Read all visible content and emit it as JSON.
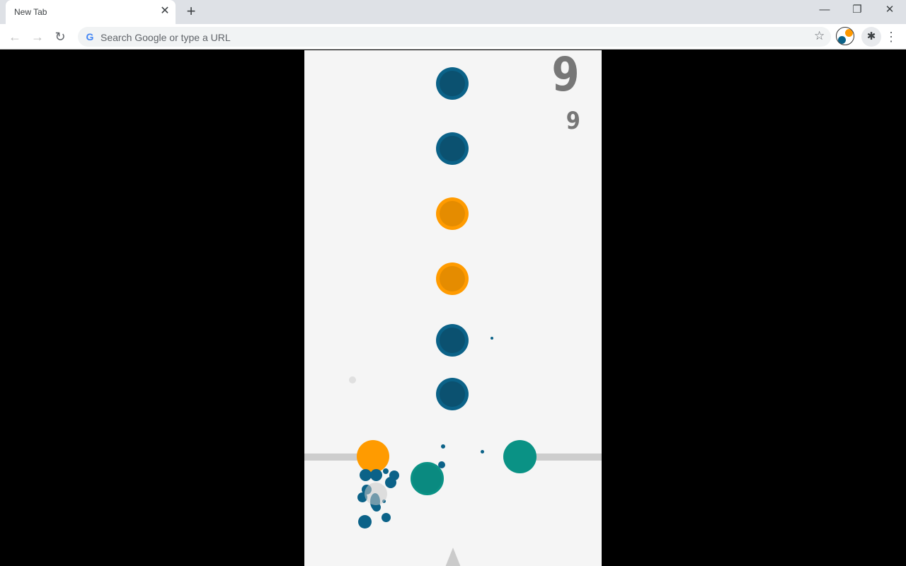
{
  "browser": {
    "tab_title": "New Tab",
    "tab_close": "✕",
    "new_tab": "+",
    "back": "←",
    "forward": "→",
    "reload": "↻",
    "omnibox_placeholder": "Search Google or type a URL",
    "google_icon": "G",
    "bookmark_star": "☆",
    "extensions_icon": "✱",
    "menu_icon": "⋮",
    "minimize": "—",
    "restore": "❐",
    "close": "✕"
  },
  "game": {
    "score": "9",
    "best_score": "9",
    "queue_balls": [
      {
        "color": "blue"
      },
      {
        "color": "blue"
      },
      {
        "color": "orange"
      },
      {
        "color": "orange"
      },
      {
        "color": "blue"
      },
      {
        "color": "blue"
      }
    ],
    "colors": {
      "blue": "#0b6288",
      "orange": "#ff9b00",
      "teal": "#0a9285",
      "background": "#f5f5f5",
      "bar": "#cdcdcd"
    }
  }
}
